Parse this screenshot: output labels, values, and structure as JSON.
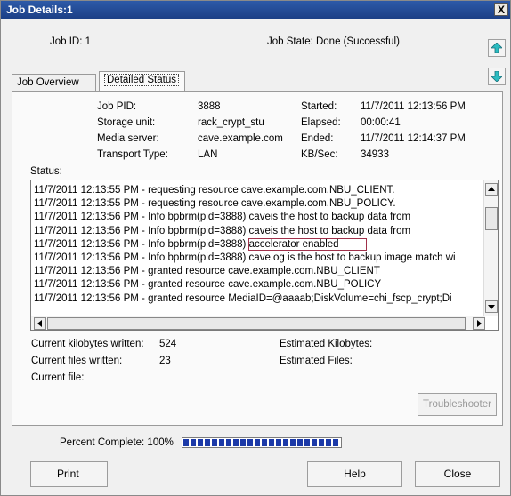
{
  "window": {
    "title": "Job Details:1",
    "close_glyph": "X"
  },
  "header": {
    "job_id": "Job ID: 1",
    "job_state": "Job State: Done (Successful)",
    "up_icon": "arrow-up-icon",
    "down_icon": "arrow-down-icon"
  },
  "tabs": [
    {
      "label": "Job Overview",
      "active": false
    },
    {
      "label": "Detailed Status",
      "active": true
    }
  ],
  "details": {
    "job_pid_label": "Job PID:",
    "job_pid_value": "3888",
    "storage_unit_label": "Storage unit:",
    "storage_unit_value": "rack_crypt_stu",
    "media_server_label": "Media server:",
    "media_server_value": "cave.example.com",
    "transport_type_label": "Transport Type:",
    "transport_type_value": "LAN",
    "started_label": "Started:",
    "started_value": "11/7/2011 12:13:56 PM",
    "elapsed_label": "Elapsed:",
    "elapsed_value": "00:00:41",
    "ended_label": "Ended:",
    "ended_value": "11/7/2011 12:14:37 PM",
    "kbsec_label": "KB/Sec:",
    "kbsec_value": "34933"
  },
  "status": {
    "label": "Status:",
    "lines": [
      "11/7/2011 12:13:55 PM - requesting resource cave.example.com.NBU_CLIENT.",
      "11/7/2011 12:13:55 PM - requesting resource cave.example.com.NBU_POLICY.",
      "11/7/2011 12:13:56 PM - Info bpbrm(pid=3888) caveis the host to backup data from",
      "11/7/2011 12:13:56 PM - Info bpbrm(pid=3888) caveis the host to backup data from",
      "11/7/2011 12:13:56 PM - Info bpbrm(pid=3888) accelerator enabled",
      "11/7/2011 12:13:56 PM - Info bpbrm(pid=3888) cave.og is the host to backup image match wi",
      "11/7/2011 12:13:56 PM - granted resource cave.example.com.NBU_CLIENT",
      "11/7/2011 12:13:56 PM - granted resource cave.example.com.NBU_POLICY",
      "11/7/2011 12:13:56 PM - granted resource MediaID=@aaaab;DiskVolume=chi_fscp_crypt;Di"
    ],
    "highlight_prefix": "11/7/2011 12:13:56 PM - Info bpbrm(pid=3888) ",
    "highlight_text": "accelerator enabled"
  },
  "stats": {
    "kb_written_label": "Current kilobytes written:",
    "kb_written_value": "524",
    "files_written_label": "Current files written:",
    "files_written_value": "23",
    "current_file_label": "Current file:",
    "est_kb_label": "Estimated Kilobytes:",
    "est_files_label": "Estimated Files:"
  },
  "troubleshooter_label": "Troubleshooter",
  "progress": {
    "label": "Percent Complete: 100%",
    "fraction": 1.0
  },
  "buttons": {
    "print": "Print",
    "help": "Help",
    "close": "Close"
  }
}
